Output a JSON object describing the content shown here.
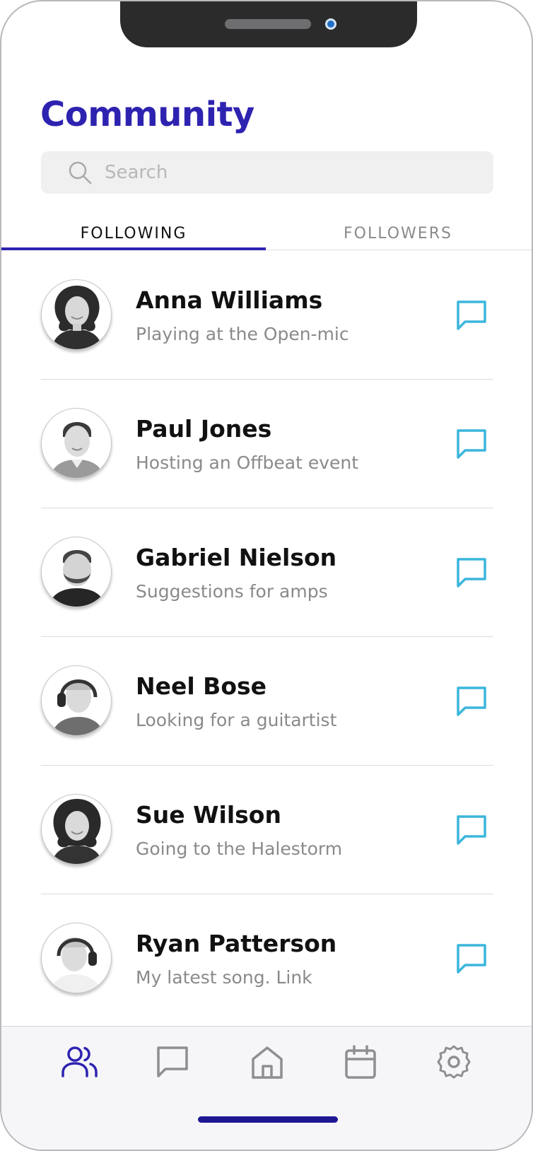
{
  "header": {
    "title": "Community"
  },
  "search": {
    "placeholder": "Search",
    "value": ""
  },
  "tabs": [
    {
      "label": "FOLLOWING",
      "active": true
    },
    {
      "label": "FOLLOWERS",
      "active": false
    }
  ],
  "people": [
    {
      "name": "Anna Williams",
      "status": "Playing at the Open-mic",
      "avatar": "woman-curly-hair-avatar"
    },
    {
      "name": "Paul Jones",
      "status": "Hosting an Offbeat event",
      "avatar": "man-short-hair-avatar"
    },
    {
      "name": "Gabriel Nielson",
      "status": "Suggestions for amps",
      "avatar": "man-beard-avatar"
    },
    {
      "name": "Neel Bose",
      "status": "Looking for a guitartist",
      "avatar": "man-headphones-avatar"
    },
    {
      "name": "Sue Wilson",
      "status": "Going to the Halestorm",
      "avatar": "woman-curly-hair-avatar"
    },
    {
      "name": "Ryan Patterson",
      "status": "My latest song. Link",
      "avatar": "man-headphones-avatar"
    }
  ],
  "bottom_nav": [
    {
      "icon": "users-icon",
      "active": true
    },
    {
      "icon": "chat-icon",
      "active": false
    },
    {
      "icon": "home-icon",
      "active": false
    },
    {
      "icon": "calendar-icon",
      "active": false
    },
    {
      "icon": "settings-icon",
      "active": false
    }
  ],
  "colors": {
    "accent": "#2e23b0",
    "chat_icon": "#3bb6dc",
    "inactive_icon": "#8e8e93",
    "home_indicator": "#1e1793"
  }
}
